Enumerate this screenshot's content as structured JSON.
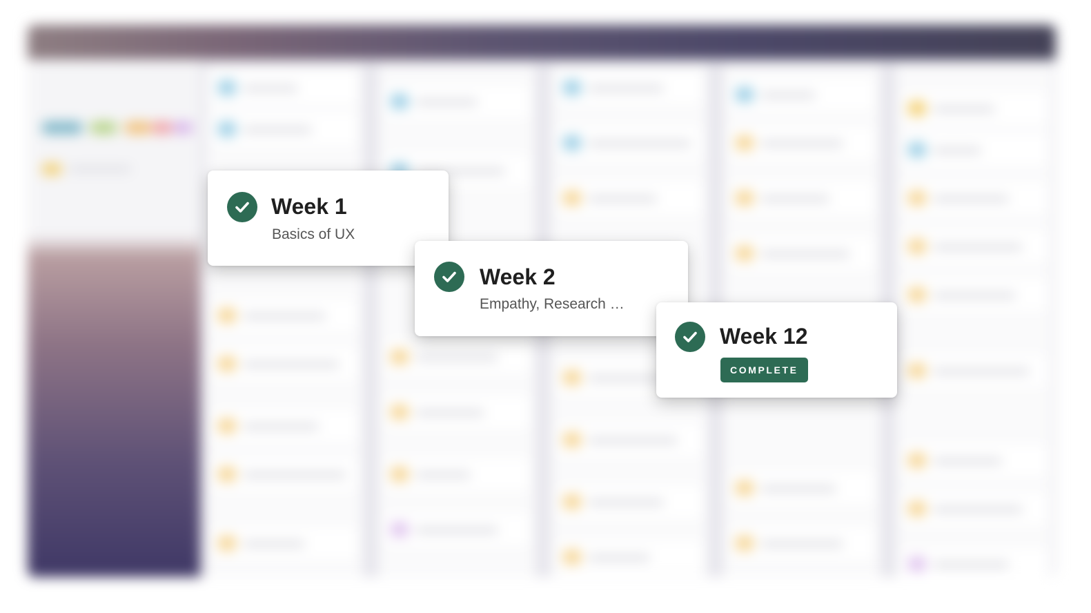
{
  "cards": [
    {
      "title": "Week 1",
      "subtitle": "Basics of UX",
      "status": "complete"
    },
    {
      "title": "Week 2",
      "subtitle": "Empathy, Research …",
      "status": "complete"
    },
    {
      "title": "Week 12",
      "badge": "COMPLETE",
      "status": "complete"
    }
  ],
  "colors": {
    "accent": "#2d6b54",
    "card_background": "#ffffff",
    "title_text": "#1f1f1f",
    "subtitle_text": "#555555"
  },
  "icons": {
    "status_icon": "check-circle-icon"
  }
}
